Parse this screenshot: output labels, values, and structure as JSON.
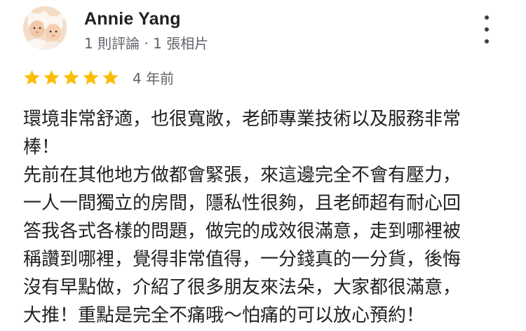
{
  "review": {
    "author_name": "Annie Yang",
    "author_meta": "1 則評論 · 1 張相片",
    "avatar_icon": "baby-photo-avatar",
    "menu_icon": "more-vert-icon",
    "rating": 5,
    "rating_max": 5,
    "star_color": "#fbbc04",
    "age": "4 年前",
    "text_lines": [
      "環境非常舒適，也很寬敞，老師專業技術以及服務非常",
      "棒！",
      "先前在其他地方做都會緊張，來這邊完全不會有壓力，",
      "一人一間獨立的房間，隱私性很夠，且老師超有耐心回",
      "答我各式各樣的問題，做完的成效很滿意，走到哪裡被",
      "稱讚到哪裡，覺得非常值得，一分錢真的一分貨，後悔",
      "沒有早點做，介紹了很多朋友來法朵，大家都很滿意，",
      "大推！重點是完全不痛哦～怕痛的可以放心預約！"
    ]
  }
}
